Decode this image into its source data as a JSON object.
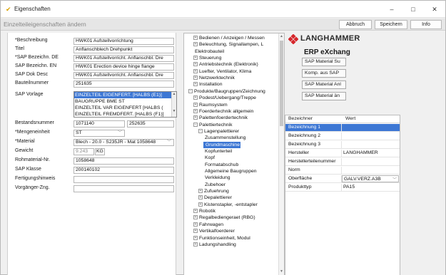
{
  "window": {
    "title": "Eigenschaften",
    "controls": {
      "minimize": "–",
      "maximize": "□",
      "close": "✕"
    }
  },
  "header": {
    "heading": "Einzelteileigenschaften ändern",
    "buttons": {
      "cancel": "Abbruch",
      "save": "Speichern",
      "info": "Info"
    }
  },
  "form": {
    "fields": [
      {
        "label": "*Beschreibung",
        "value": "HWK01 Aufstellvorrichtung"
      },
      {
        "label": "Titel",
        "value": "Anflanschblech Drehpunkt"
      },
      {
        "label": "*SAP Bezeichn. DE",
        "value": "HWK01 Aufstellvorricht. Anflanschbl. Dre"
      },
      {
        "label": "SAP Bezeichn. EN",
        "value": "HWK01 Erection device hinge flange"
      },
      {
        "label": "SAP Dok Desc",
        "value": "HWK01 Aufstellvorricht. Anflanschbl. Dre"
      },
      {
        "label": "Bauteilnummer",
        "value": "251635"
      }
    ],
    "vorlage": {
      "label": "SAP Vorlage",
      "items": [
        "EINZELTEIL EIGENFERT. [HALBS (E1)]",
        "BAUGRUPPE BME ST",
        "EINZELTEIL VAR EIGENFERT [HALBS (",
        "EINZELTEIL FREMDFERT. [HALBS (F1)]"
      ],
      "selected_index": 0
    },
    "bestandsnummer": {
      "label": "Bestandsnummer",
      "value1": "1071140",
      "value2": "252635"
    },
    "mengeneinheit": {
      "label": "*Mengeneinheit",
      "value": "ST"
    },
    "material": {
      "label": "*Material",
      "value": "Blech - 20.0 - S235JR - Mat 1058648"
    },
    "gewicht": {
      "label": "Gewicht",
      "value": "9.243",
      "unit": "KG"
    },
    "rohmaterial": {
      "label": "Rohmaterial-Nr.",
      "value": "1058648"
    },
    "sap_klasse": {
      "label": "SAP Klasse",
      "value": "200140102"
    },
    "fertigungshinweis": {
      "label": "Fertigungshinweis",
      "value": ""
    },
    "vorgaenger": {
      "label": "Vorgänger-Zng.",
      "value": ""
    }
  },
  "tree": {
    "nodes": [
      {
        "label": "Bedienen / Anzeigen / Messen",
        "toggle": "+",
        "indent": 1
      },
      {
        "label": "Beleuchtung, Signallampen, L",
        "toggle": "+",
        "indent": 1
      },
      {
        "label": "Elektrobauteil",
        "toggle": "",
        "indent": 1
      },
      {
        "label": "Steuerung",
        "toggle": "+",
        "indent": 1
      },
      {
        "label": "Antriebstechnik (Elektronik)",
        "toggle": "+",
        "indent": 1
      },
      {
        "label": "Luefter, Ventilator, Klima",
        "toggle": "+",
        "indent": 1
      },
      {
        "label": "Netzwerktechnik",
        "toggle": "+",
        "indent": 1
      },
      {
        "label": "Installation",
        "toggle": "+",
        "indent": 1
      },
      {
        "label": "Produkte/Baugruppen/Zeichnung",
        "toggle": "−",
        "indent": 0
      },
      {
        "label": "Podest/Uebergang/Treppe",
        "toggle": "+",
        "indent": 1
      },
      {
        "label": "Raumsystem",
        "toggle": "+",
        "indent": 1
      },
      {
        "label": "Foerdertechnik allgemein",
        "toggle": "+",
        "indent": 1
      },
      {
        "label": "Palettenfoerdertechnik",
        "toggle": "+",
        "indent": 1
      },
      {
        "label": "Palettiertechnik",
        "toggle": "−",
        "indent": 1
      },
      {
        "label": "Lagenpalettierer",
        "toggle": "−",
        "indent": 2
      },
      {
        "label": "Zusammenstellung",
        "toggle": "",
        "indent": 3
      },
      {
        "label": "Grundmaschine",
        "toggle": "",
        "indent": 3,
        "selected": true
      },
      {
        "label": "Kopfunterteil",
        "toggle": "",
        "indent": 3
      },
      {
        "label": "Kopf",
        "toggle": "",
        "indent": 3
      },
      {
        "label": "Formatabschub",
        "toggle": "",
        "indent": 3
      },
      {
        "label": "Allgemeine Baugruppen",
        "toggle": "",
        "indent": 3
      },
      {
        "label": "Verkleidung",
        "toggle": "",
        "indent": 3
      },
      {
        "label": "Zubehoer",
        "toggle": "",
        "indent": 3
      },
      {
        "label": "Zufuehrung",
        "toggle": "+",
        "indent": 2
      },
      {
        "label": "Depalettierer",
        "toggle": "+",
        "indent": 2
      },
      {
        "label": "Kistenstapler, -entstapler",
        "toggle": "+",
        "indent": 2
      },
      {
        "label": "Robotik",
        "toggle": "+",
        "indent": 1
      },
      {
        "label": "Regalbediengeraet (RBG)",
        "toggle": "+",
        "indent": 1
      },
      {
        "label": "Fahrwagen",
        "toggle": "+",
        "indent": 1
      },
      {
        "label": "Vertikalfoerderer",
        "toggle": "+",
        "indent": 1
      },
      {
        "label": "Funktionseinheit, Modul",
        "toggle": "+",
        "indent": 1
      },
      {
        "label": "Ladungshandling",
        "toggle": "+",
        "indent": 1
      }
    ]
  },
  "right": {
    "logo_text": "LANGHAMMER",
    "logo_sub": "",
    "erp_title": "ERP eXchang",
    "buttons": [
      "SAP Material Su",
      "Komp. aus SAP",
      "SAP Material Anl",
      "SAP Material än"
    ],
    "props": {
      "col_key": "Bezeichner",
      "col_value": "Wert",
      "rows": [
        {
          "key": "Bezeichnung 1",
          "value": "",
          "selected": true
        },
        {
          "key": "Bezeichnung 2",
          "value": ""
        },
        {
          "key": "Bezeichnung 3",
          "value": ""
        },
        {
          "key": "Hersteller",
          "value": "LANGHAMMER"
        },
        {
          "key": "Herstellerteilenummer",
          "value": ""
        },
        {
          "key": "Norm",
          "value": ""
        },
        {
          "key": "Oberfläche",
          "value": "GALV.VERZ.A3B",
          "dropdown": true
        },
        {
          "key": "Produkttyp",
          "value": "PA15"
        }
      ]
    }
  },
  "colors": {
    "selection": "#3d77d4",
    "window_bg": "#f0f0f0",
    "logo_red": "#d6262b"
  }
}
